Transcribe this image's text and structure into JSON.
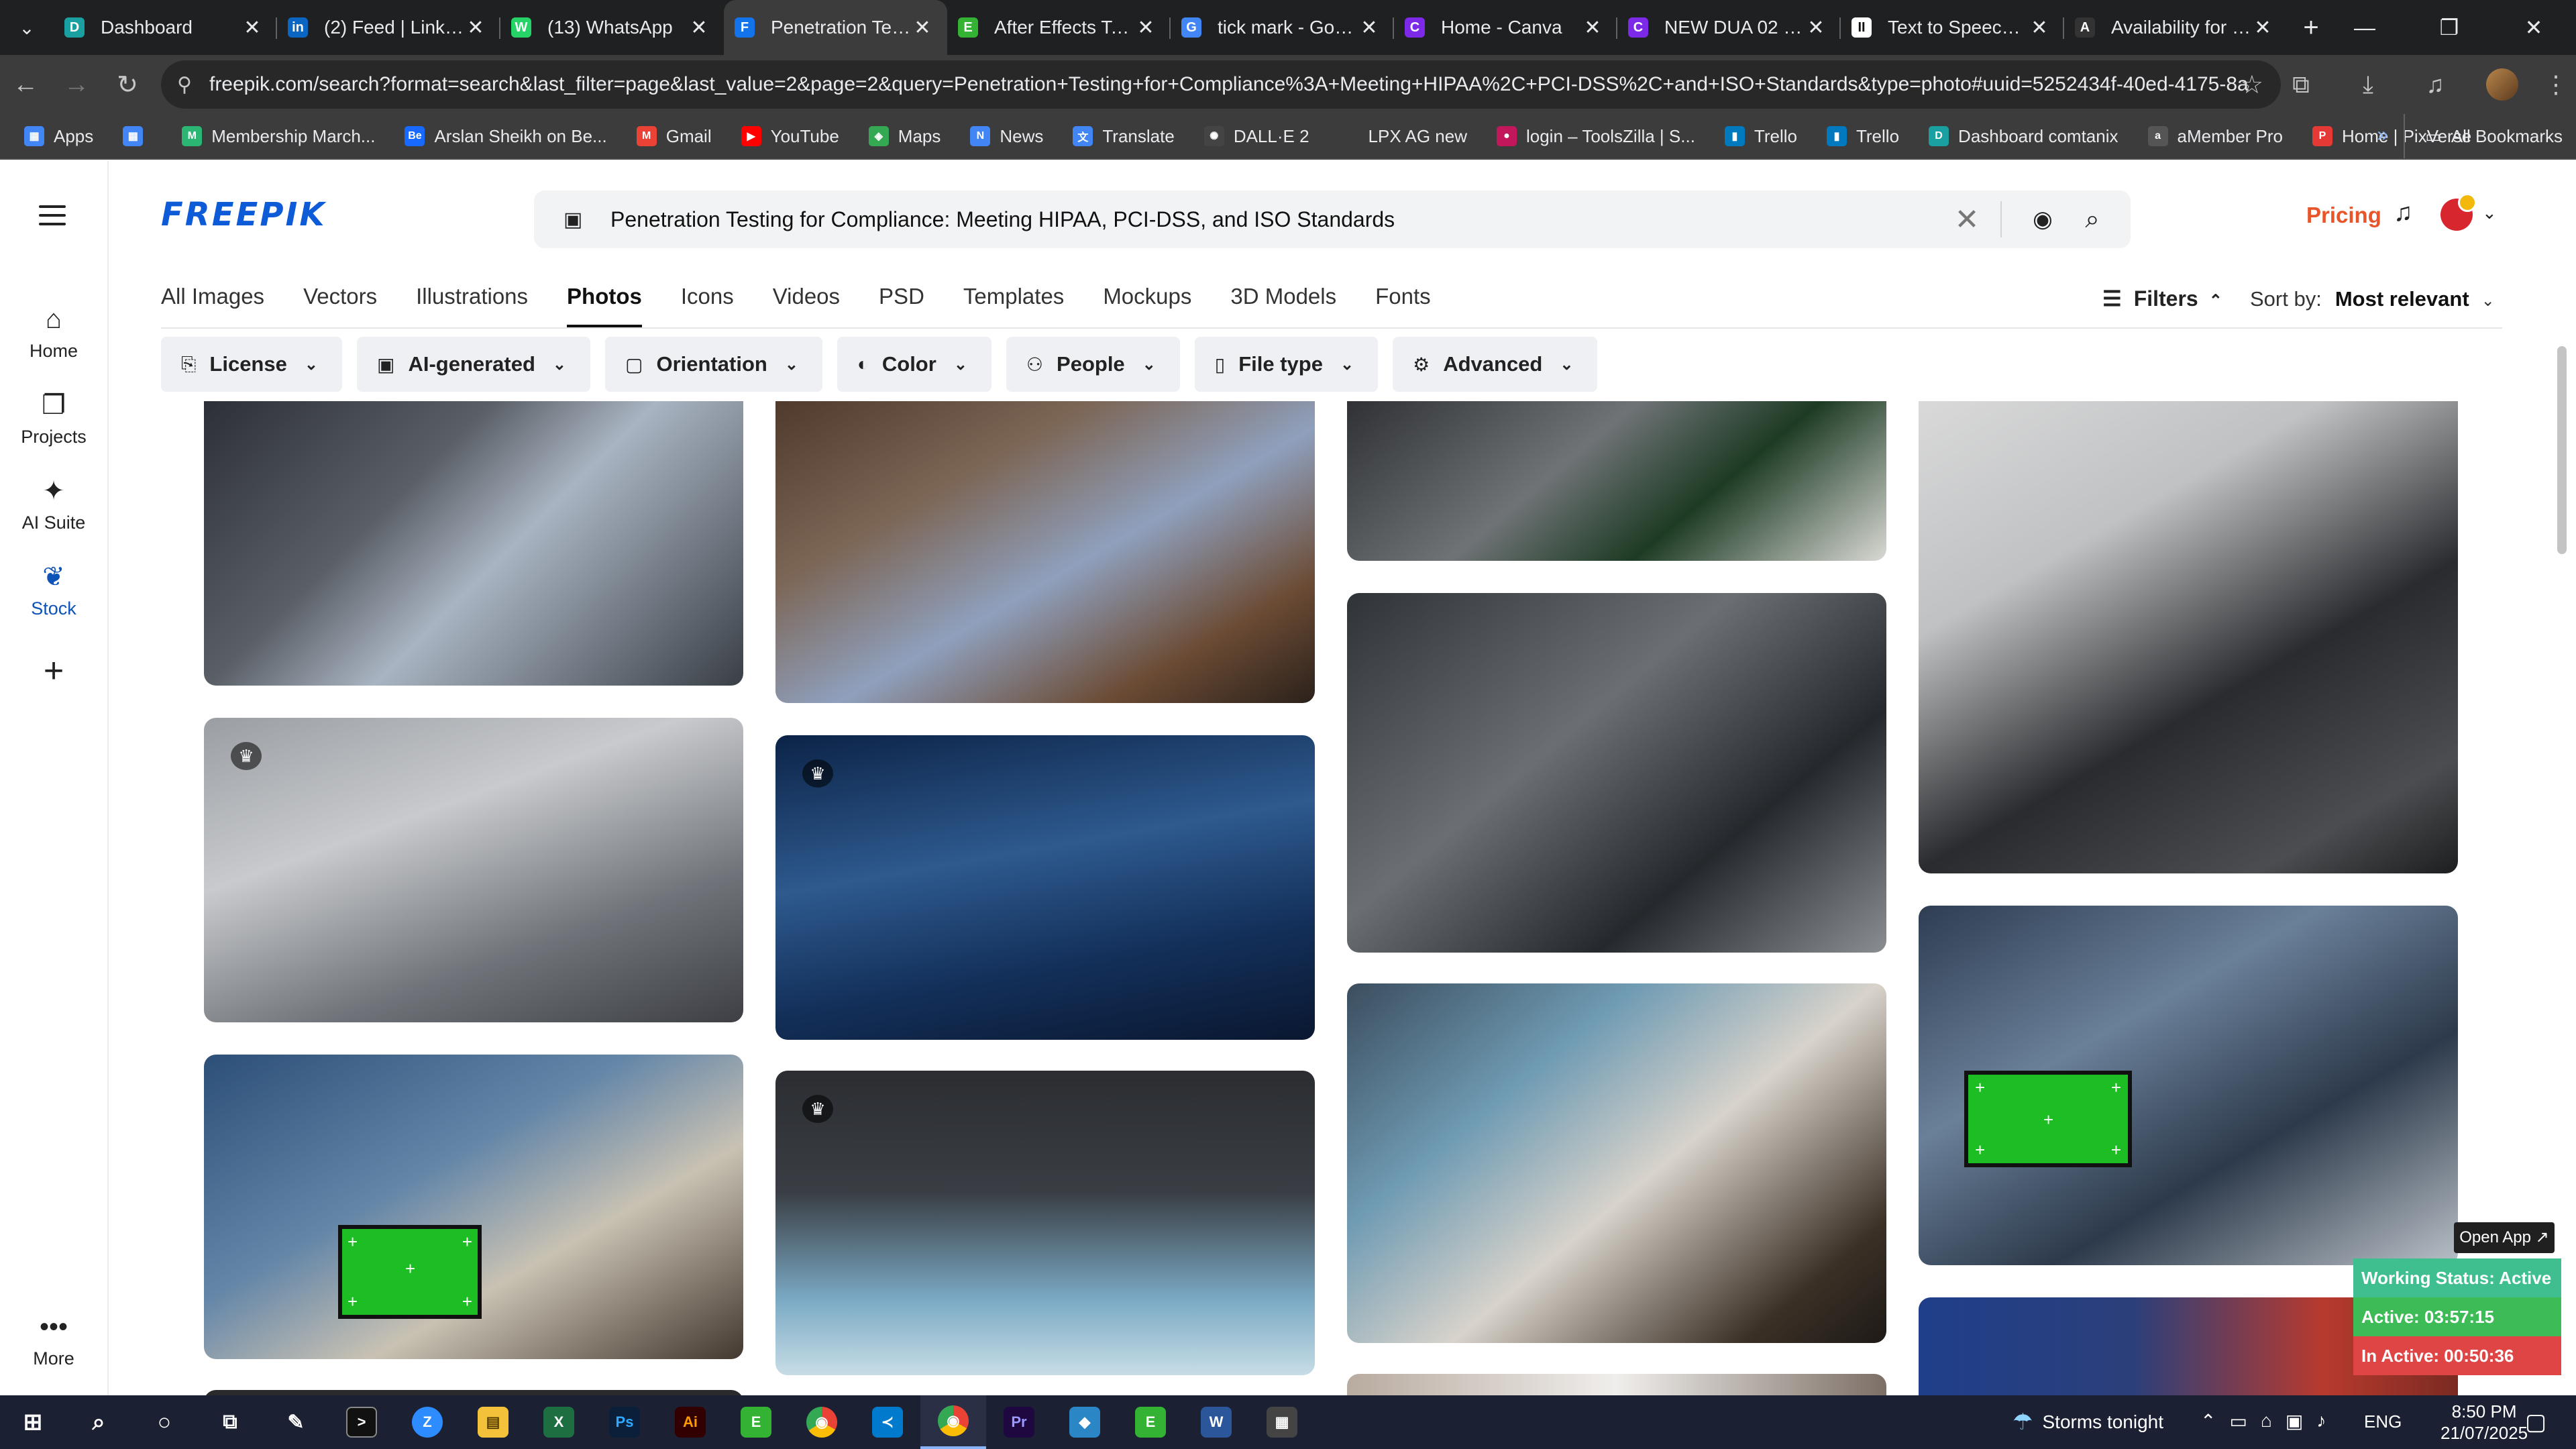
{
  "browser": {
    "tabs": [
      {
        "title": "Dashboard",
        "color": "#1aa0a0",
        "glyph": "D"
      },
      {
        "title": "(2) Feed | LinkedIn",
        "color": "#0a66c2",
        "glyph": "in"
      },
      {
        "title": "(13) WhatsApp",
        "color": "#25d366",
        "glyph": "W"
      },
      {
        "title": "Penetration Testing",
        "color": "#1273eb",
        "glyph": "F"
      },
      {
        "title": "After Effects Temp",
        "color": "#34b233",
        "glyph": "E"
      },
      {
        "title": "tick mark - Google",
        "color": "#4285f4",
        "glyph": "G"
      },
      {
        "title": "Home - Canva",
        "color": "#7d2ae8",
        "glyph": "C"
      },
      {
        "title": "NEW DUA 02 - M",
        "color": "#7d2ae8",
        "glyph": "C"
      },
      {
        "title": "Text to Speech | E",
        "color": "#ffffff",
        "glyph": "II"
      },
      {
        "title": "Availability for ES",
        "color": "#333333",
        "glyph": "A"
      }
    ],
    "url": "freepik.com/search?format=search&last_filter=page&last_value=2&page=2&query=Penetration+Testing+for+Compliance%3A+Meeting+HIPAA%2C+PCI-DSS%2C+and+ISO+Standards&type=photo#uuid=5252434f-40ed-4175-8a7c-69a97cc...",
    "bookmarks": [
      {
        "label": "Apps",
        "color": "#4285f4"
      },
      {
        "label": "",
        "color": "#4285f4"
      },
      {
        "label": "Membership March...",
        "color": "#2bb673"
      },
      {
        "label": "Arslan Sheikh on Be...",
        "color": "#1769ff"
      },
      {
        "label": "Gmail",
        "color": "#ea4335"
      },
      {
        "label": "YouTube",
        "color": "#ff0000"
      },
      {
        "label": "Maps",
        "color": "#34a853"
      },
      {
        "label": "News",
        "color": "#4285f4"
      },
      {
        "label": "Translate",
        "color": "#4285f4"
      },
      {
        "label": "DALL·E 2",
        "color": "#444444"
      },
      {
        "label": "LPX AG new",
        "color": "#3c3c3c"
      },
      {
        "label": "login – ToolsZilla | S...",
        "color": "#c2185b"
      },
      {
        "label": "Trello",
        "color": "#0079bf"
      },
      {
        "label": "Trello",
        "color": "#0079bf"
      },
      {
        "label": "Dashboard comtanix",
        "color": "#1aa0a0"
      },
      {
        "label": "aMember Pro",
        "color": "#555555"
      },
      {
        "label": "Home | PixVerse",
        "color": "#e53935"
      }
    ],
    "all_bookmarks": "All Bookmarks"
  },
  "rail": {
    "items": [
      {
        "label": "Home",
        "icon": "⌂"
      },
      {
        "label": "Projects",
        "icon": "❐"
      },
      {
        "label": "AI Suite",
        "icon": "✦"
      },
      {
        "label": "Stock",
        "icon": "❦"
      },
      {
        "label": "",
        "icon": "+"
      }
    ],
    "more": "More"
  },
  "header": {
    "logo": "FREEPIK",
    "query": "Penetration Testing for Compliance: Meeting HIPAA, PCI-DSS, and ISO Standards",
    "pricing": "Pricing"
  },
  "tabs": [
    "All Images",
    "Vectors",
    "Illustrations",
    "Photos",
    "Icons",
    "Videos",
    "PSD",
    "Templates",
    "Mockups",
    "3D Models",
    "Fonts"
  ],
  "filters_label": "Filters",
  "sort": {
    "label": "Sort by:",
    "value": "Most relevant"
  },
  "chips": [
    {
      "label": "License",
      "icon": "⎘"
    },
    {
      "label": "AI-generated",
      "icon": "▣"
    },
    {
      "label": "Orientation",
      "icon": "▢"
    },
    {
      "label": "Color",
      "icon": "◐"
    },
    {
      "label": "People",
      "icon": "⚇"
    },
    {
      "label": "File type",
      "icon": "▯"
    },
    {
      "label": "Advanced",
      "icon": "⚙"
    }
  ],
  "widget": {
    "open_app": "Open App ↗",
    "working": "Working Status: Active",
    "active": "Active: 03:57:15",
    "inactive": "In Active: 00:50:36"
  },
  "taskbar": {
    "apps": [
      {
        "name": "start",
        "color": "#1c2033",
        "glyph": "⊞"
      },
      {
        "name": "search",
        "color": "#1c2033",
        "glyph": "⌕"
      },
      {
        "name": "cortana",
        "color": "#1c2033",
        "glyph": "○"
      },
      {
        "name": "taskview",
        "color": "#1c2033",
        "glyph": "⧉"
      },
      {
        "name": "pen",
        "color": "#1c2033",
        "glyph": "✎"
      },
      {
        "name": "terminal",
        "color": "#111111",
        "glyph": ">"
      },
      {
        "name": "zoom",
        "color": "#2d8cff",
        "glyph": "Z"
      },
      {
        "name": "explorer",
        "color": "#f3c13a",
        "glyph": "▤"
      },
      {
        "name": "excel",
        "color": "#1d6f42",
        "glyph": "X"
      },
      {
        "name": "photoshop",
        "color": "#0b1f3a",
        "glyph": "Ps"
      },
      {
        "name": "illustrator",
        "color": "#330000",
        "glyph": "Ai"
      },
      {
        "name": "app-green",
        "color": "#34b233",
        "glyph": "E"
      },
      {
        "name": "chrome",
        "color": "#e8453c",
        "glyph": "◉"
      },
      {
        "name": "vscode",
        "color": "#007acc",
        "glyph": "≺"
      },
      {
        "name": "chrome-2",
        "color": "#e8453c",
        "glyph": "◉"
      },
      {
        "name": "premiere",
        "color": "#1f0740",
        "glyph": "Pr"
      },
      {
        "name": "app-diamond",
        "color": "#2b86c5",
        "glyph": "◆"
      },
      {
        "name": "app-green-2",
        "color": "#34b233",
        "glyph": "E"
      },
      {
        "name": "word",
        "color": "#2b579a",
        "glyph": "W"
      },
      {
        "name": "calculator",
        "color": "#444444",
        "glyph": "▦"
      }
    ],
    "weather": "Storms tonight",
    "lang": "ENG",
    "time": "8:50 PM",
    "date": "21/07/2025"
  }
}
